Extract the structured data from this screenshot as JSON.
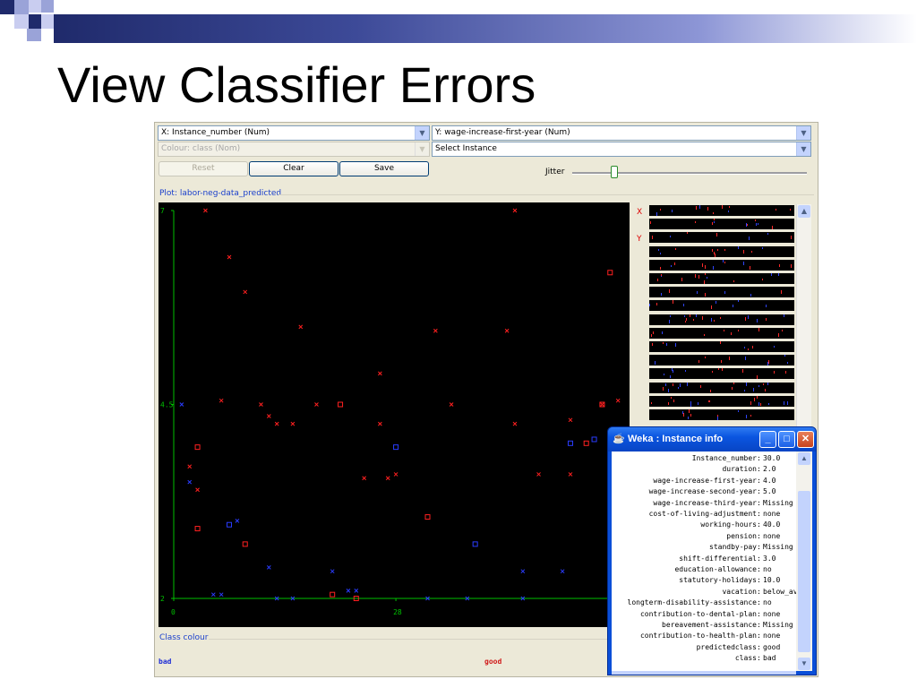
{
  "slide": {
    "title": "View Classifier Errors"
  },
  "weka": {
    "x_axis_select": "X: Instance_number (Num)",
    "y_axis_select": "Y: wage-increase-first-year (Num)",
    "colour_select": "Colour: class (Nom)",
    "instance_select": "Select Instance",
    "reset_label": "Reset",
    "clear_label": "Clear",
    "save_label": "Save",
    "jitter_label": "Jitter",
    "jitter_level": 0.18,
    "plot_title": "Plot: labor-neg-data_predicted",
    "class_colour_label": "Class colour",
    "legend": [
      {
        "label": "bad",
        "color": "#1c2bd6"
      },
      {
        "label": "good",
        "color": "#d01a1a"
      }
    ],
    "strip_labels": {
      "x": "X",
      "y": "Y"
    }
  },
  "chart_data": {
    "type": "scatter",
    "xlabel": "",
    "ylabel": "",
    "x_ticks": [
      "0",
      "28"
    ],
    "y_ticks": [
      "2",
      "4.5",
      "7"
    ],
    "xlim": [
      0,
      57
    ],
    "ylim": [
      2,
      7
    ],
    "axis_color": "#00c000",
    "series": [
      {
        "name": "good",
        "color": "#ff2020",
        "marker": "x",
        "points": [
          [
            4,
            7.0
          ],
          [
            7,
            6.4
          ],
          [
            9,
            5.95
          ],
          [
            16,
            5.5
          ],
          [
            26,
            4.9
          ],
          [
            6,
            4.55
          ],
          [
            11,
            4.5
          ],
          [
            12,
            4.35
          ],
          [
            13,
            4.25
          ],
          [
            15,
            4.25
          ],
          [
            18,
            4.5
          ],
          [
            26,
            4.25
          ],
          [
            27,
            3.55
          ],
          [
            28,
            3.6
          ],
          [
            35,
            4.5
          ],
          [
            42,
            5.45
          ],
          [
            43,
            4.25
          ],
          [
            46,
            3.6
          ],
          [
            50,
            3.6
          ],
          [
            50,
            4.3
          ],
          [
            54,
            4.5
          ],
          [
            56,
            4.55
          ],
          [
            55,
            3.9
          ],
          [
            2,
            3.7
          ],
          [
            3,
            3.4
          ],
          [
            43,
            7.0
          ],
          [
            33,
            5.45
          ],
          [
            24,
            3.55
          ]
        ]
      },
      {
        "name": "good (incorrect)",
        "color": "#ff2020",
        "marker": "square",
        "points": [
          [
            3,
            3.95
          ],
          [
            3,
            2.9
          ],
          [
            9,
            2.7
          ],
          [
            21,
            4.5
          ],
          [
            20,
            2.05
          ],
          [
            23,
            2.0
          ],
          [
            32,
            3.05
          ],
          [
            55,
            6.2
          ],
          [
            54,
            4.5
          ],
          [
            52,
            4.0
          ]
        ]
      },
      {
        "name": "bad",
        "color": "#2a3cff",
        "marker": "x",
        "points": [
          [
            1,
            4.5
          ],
          [
            2,
            3.5
          ],
          [
            5,
            2.05
          ],
          [
            8,
            3.0
          ],
          [
            12,
            2.4
          ],
          [
            20,
            2.35
          ],
          [
            22,
            2.1
          ],
          [
            23,
            2.1
          ],
          [
            32,
            2.0
          ],
          [
            37,
            2.0
          ],
          [
            44,
            2.35
          ],
          [
            49,
            2.35
          ],
          [
            55,
            2.0
          ],
          [
            15,
            2.0
          ],
          [
            44,
            2.0
          ],
          [
            13,
            2.0
          ],
          [
            6,
            2.05
          ]
        ]
      },
      {
        "name": "bad (incorrect)",
        "color": "#2a3cff",
        "marker": "square",
        "points": [
          [
            7,
            2.95
          ],
          [
            28,
            3.95
          ],
          [
            38,
            2.7
          ],
          [
            50,
            4.0
          ],
          [
            53,
            4.05
          ]
        ]
      }
    ]
  },
  "instance_info": {
    "window_title": "Weka : Instance info",
    "rows": [
      {
        "key": "Instance_number",
        "value": "30.0"
      },
      {
        "key": "duration",
        "value": "2.0"
      },
      {
        "key": "wage-increase-first-year",
        "value": "4.0"
      },
      {
        "key": "wage-increase-second-year",
        "value": "5.0"
      },
      {
        "key": "wage-increase-third-year",
        "value": "Missing"
      },
      {
        "key": "cost-of-living-adjustment",
        "value": "none"
      },
      {
        "key": "working-hours",
        "value": "40.0"
      },
      {
        "key": "pension",
        "value": "none"
      },
      {
        "key": "standby-pay",
        "value": "Missing"
      },
      {
        "key": "shift-differential",
        "value": "3.0"
      },
      {
        "key": "education-allowance",
        "value": "no"
      },
      {
        "key": "statutory-holidays",
        "value": "10.0"
      },
      {
        "key": "vacation",
        "value": "below_ave"
      },
      {
        "key": "longterm-disability-assistance",
        "value": "no"
      },
      {
        "key": "contribution-to-dental-plan",
        "value": "none"
      },
      {
        "key": "bereavement-assistance",
        "value": "Missing"
      },
      {
        "key": "contribution-to-health-plan",
        "value": "none"
      },
      {
        "key": "predictedclass",
        "value": "good"
      },
      {
        "key": "class",
        "value": "bad"
      }
    ]
  }
}
